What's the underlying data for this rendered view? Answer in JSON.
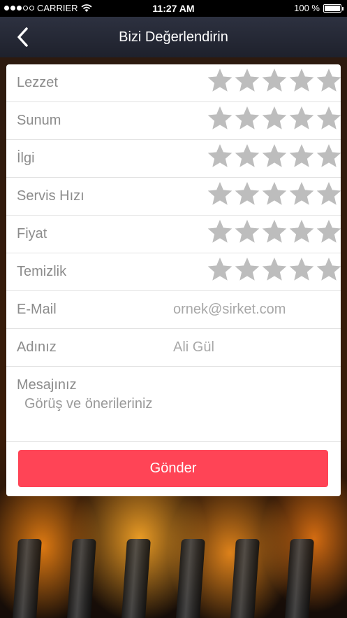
{
  "status_bar": {
    "carrier": "CARRIER",
    "time": "11:27 AM",
    "battery": "100 %"
  },
  "nav": {
    "title": "Bizi Değerlendirin",
    "back_icon": "chevron-left-icon"
  },
  "ratings": [
    {
      "label": "Lezzet",
      "stars": 5,
      "filled": 0
    },
    {
      "label": "Sunum",
      "stars": 5,
      "filled": 0
    },
    {
      "label": "İlgi",
      "stars": 5,
      "filled": 0
    },
    {
      "label": "Servis Hızı",
      "stars": 5,
      "filled": 0
    },
    {
      "label": "Fiyat",
      "stars": 5,
      "filled": 0
    },
    {
      "label": "Temizlik",
      "stars": 5,
      "filled": 0
    }
  ],
  "form": {
    "email_label": "E-Mail",
    "email_placeholder": "ornek@sirket.com",
    "name_label": "Adınız",
    "name_placeholder": "Ali Gül",
    "message_label": "Mesajınız",
    "message_placeholder": "Görüş ve önerileriniz",
    "submit_label": "Gönder"
  },
  "colors": {
    "accent": "#ff4456",
    "star_empty": "#bdbdbd",
    "navbar": "#262a36"
  }
}
